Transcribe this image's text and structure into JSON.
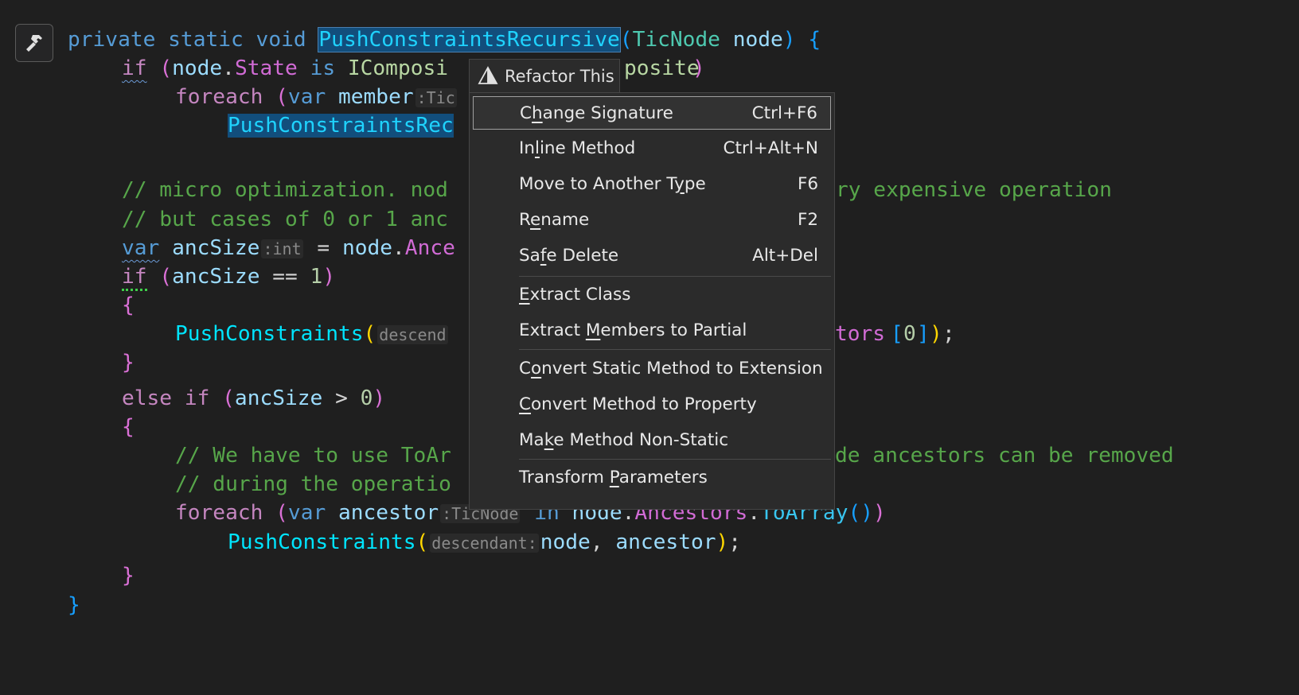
{
  "code": {
    "l1": [
      "private",
      "static",
      "void",
      "PushConstraintsRecursive",
      "(",
      "TicNode",
      " node",
      ")",
      " {"
    ],
    "l2": [
      "if",
      " (",
      "node",
      ".",
      "State",
      " is",
      " IComposi",
      "posite",
      ")"
    ],
    "l3": [
      "foreach",
      " (",
      "var",
      " member",
      ":Tic"
    ],
    "l4": [
      "PushConstraintsRec"
    ],
    "l5": [
      "// micro optimization. nod",
      "ry expensive operation"
    ],
    "l6": [
      "// but cases of 0 or 1 anc"
    ],
    "l7": [
      "var",
      " ancSize",
      ":int",
      " = ",
      "node",
      ".",
      "Ance"
    ],
    "l8": [
      "if",
      " (",
      "ancSize",
      " == ",
      "1",
      ")"
    ],
    "l9": [
      "{"
    ],
    "l10": [
      "PushConstraints",
      "(",
      "descend",
      "tors",
      "[",
      "0",
      "]",
      ")",
      ";"
    ],
    "l11": [
      "}"
    ],
    "l12": [
      "else if",
      " (",
      "ancSize",
      " > ",
      "0",
      ")"
    ],
    "l13": [
      "{"
    ],
    "l14": [
      "// We have to use ToAr",
      "de ancestors can be removed"
    ],
    "l15": [
      "// during the operatio"
    ],
    "l16": [
      "foreach",
      " (",
      "var",
      " ancestor",
      ":TicNode",
      " in ",
      "node",
      ".",
      "Ancestors",
      ".",
      "ToArray",
      "()",
      ")"
    ],
    "l17": [
      "PushConstraints",
      "(",
      "descendant:",
      "node",
      ", ",
      "ancestor",
      ")",
      ";"
    ],
    "l18": [
      "}"
    ],
    "l19": [
      "}"
    ]
  },
  "gutter": {
    "icon": "hammer-icon"
  },
  "refactor_header": {
    "icon": "refactor-icon",
    "label": "Refactor This"
  },
  "menu": {
    "items": [
      {
        "label": "Change Signature",
        "shortcut": "Ctrl+F6",
        "mnemonic": "h"
      },
      {
        "label": "Inline Method",
        "shortcut": "Ctrl+Alt+N",
        "mnemonic": "l"
      },
      {
        "label": "Move to Another Type",
        "shortcut": "F6",
        "mnemonic": "y"
      },
      {
        "label": "Rename",
        "shortcut": "F2",
        "mnemonic": "e"
      },
      {
        "label": "Safe Delete",
        "shortcut": "Alt+Del",
        "mnemonic": "f"
      },
      {
        "label": "Extract Class",
        "shortcut": "",
        "mnemonic": "E"
      },
      {
        "label": "Extract Members to Partial",
        "shortcut": "",
        "mnemonic": "M"
      },
      {
        "label": "Convert Static Method to Extension",
        "shortcut": "",
        "mnemonic": "o"
      },
      {
        "label": "Convert Method to Property",
        "shortcut": "",
        "mnemonic": "C"
      },
      {
        "label": "Make Method Non-Static",
        "shortcut": "",
        "mnemonic": "k"
      },
      {
        "label": "Transform Parameters",
        "shortcut": "",
        "mnemonic": "P"
      }
    ],
    "highlighted_index": 0
  },
  "colors": {
    "background": "#1f1f1f",
    "keyword": "#569cd6",
    "control": "#c586c0",
    "type": "#4ec9b0",
    "comment": "#57a64a",
    "selection": "#124e7c",
    "menu_bg": "#2b2b2b"
  }
}
